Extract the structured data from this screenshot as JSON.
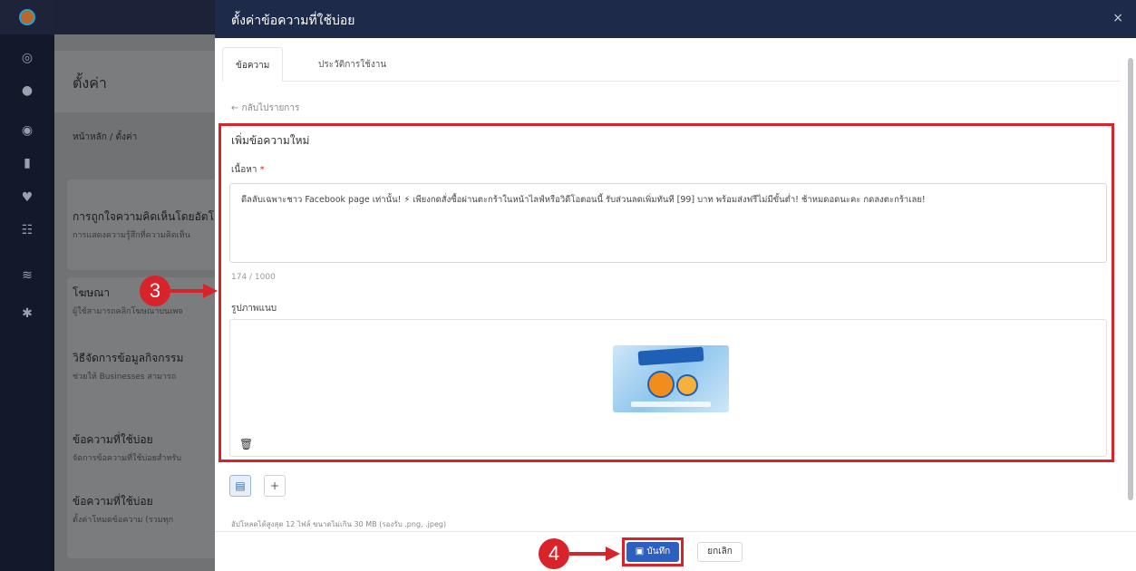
{
  "rail": {
    "icons": [
      "target-icon",
      "chat-icon",
      "messenger-icon",
      "clipboard-icon",
      "heart-icon",
      "users-icon",
      "chart-icon",
      "settings-icon"
    ]
  },
  "background": {
    "page_title": "ตั้งค่า",
    "breadcrumb": "หน้าหลัก / ตั้งค่า",
    "cards": [
      {
        "title": "การถูกใจความคิดเห็นโดยอัตโนมัติ",
        "subtitle": "การแสดงความรู้สึกที่ความคิดเห็น"
      },
      {
        "title": "โฆษณา",
        "subtitle": "ผู้ใช้สามารถคลิกโฆษณาบนเพจ"
      },
      {
        "title": "วิธีจัดการข้อมูลกิจกรรม",
        "subtitle": "ช่วยให้ Businesses สามารถ"
      },
      {
        "title": "ข้อความที่ใช้บ่อย",
        "subtitle": "จัดการข้อความที่ใช้บ่อยสำหรับ"
      },
      {
        "title": "ข้อความที่ใช้บ่อย",
        "subtitle": "ตั้งค่าโหมดข้อความ (รวมทุก"
      }
    ]
  },
  "modal": {
    "title": "ตั้งค่าข้อความที่ใช้บ่อย",
    "close": "×",
    "tabs": [
      {
        "label": "ข้อความ",
        "active": true
      },
      {
        "label": "ประวัติการใช้งาน",
        "active": false
      }
    ],
    "back_link": "← กลับไปรายการ",
    "form_title": "เพิ่มข้อความใหม่",
    "content_label": "เนื้อหา",
    "required_mark": "*",
    "content_value": "ดีลลับเฉพาะชาว Facebook page เท่านั้น! ⚡ เพียงกดสั่งซื้อผ่านตะกร้าในหน้าไลฟ์หรือวิดีโอตอนนี้ รับส่วนลดเพิ่มทันที [99] บาท พร้อมส่งฟรีไม่มีขั้นต่ำ! ช้าหมดอดนะคะ กดลงตะกร้าเลย!",
    "counter": "174 / 1000",
    "attach_label": "รูปภาพแนบ",
    "thumbnail_label": "FACEBOOK PAGE EXCLUSIVE",
    "hint": "อัปโหลดได้สูงสุด 12 ไฟล์ ขนาดไม่เกิน 30 MB (รองรับ .png, .jpeg)",
    "add_symbol": "+",
    "save_label": "บันทึก",
    "cancel_label": "ยกเลิก"
  },
  "annotations": {
    "step_a": "3",
    "step_b": "4"
  },
  "colors": {
    "highlight": "#d8232a",
    "primary": "#2c5fc0",
    "header": "#1e2a4a"
  }
}
